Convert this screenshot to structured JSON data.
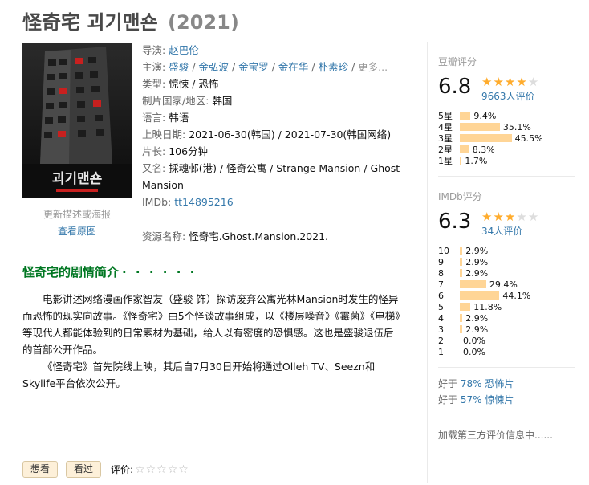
{
  "title": {
    "main": "怪奇宅 괴기맨숀",
    "year": "(2021)"
  },
  "poster": {
    "korean_title": "괴기맨숀",
    "link_update": "更新描述或海报",
    "link_view": "查看原图"
  },
  "info": {
    "director_label": "导演:",
    "director": "赵巴伦",
    "cast_label": "主演:",
    "cast": [
      "盛骏",
      "金弘波",
      "金宝罗",
      "金在华",
      "朴素珍"
    ],
    "cast_separator": " / ",
    "cast_more": "更多...",
    "genre_label": "类型:",
    "genre": "惊悚 / 恐怖",
    "country_label": "制片国家/地区:",
    "country": "韩国",
    "language_label": "语言:",
    "language": "韩语",
    "release_label": "上映日期:",
    "release": "2021-06-30(韩国) / 2021-07-30(韩国网络)",
    "runtime_label": "片长:",
    "runtime": "106分钟",
    "aka_label": "又名:",
    "aka": "採魂邨(港) / 怪奇公寓 / Strange Mansion / Ghost Mansion",
    "imdb_label": "IMDb:",
    "imdb": "tt14895216",
    "resource_label": "资源名称:",
    "resource": "怪奇宅.Ghost.Mansion.2021."
  },
  "synopsis": {
    "title": "怪奇宅的剧情简介",
    "dots": "· · · · · ·",
    "p1": "电影讲述网络漫画作家智友（盛骏 饰）探访废弃公寓光林Mansion时发生的怪异而恐怖的现实向故事。《怪奇宅》由5个怪谈故事组成，以《楼层噪音》《霉菌》《电梯》等现代人都能体验到的日常素材为基础，给人以有密度的恐惧感。这也是盛骏退伍后的首部公开作品。",
    "p2": "《怪奇宅》首先院线上映，其后自7月30日开始将通过Olleh TV、Seezn和Skylife平台依次公开。"
  },
  "actions": {
    "want": "想看",
    "seen": "看过",
    "rate_label": "评价:",
    "stars_empty": "☆☆☆☆☆"
  },
  "douban": {
    "label": "豆瓣评分",
    "score": "6.8",
    "stars_filled": 3.5,
    "votes": "9663人评价",
    "bars": [
      {
        "label": "5星",
        "pct": "9.4%",
        "value": 9.4
      },
      {
        "label": "4星",
        "pct": "35.1%",
        "value": 35.1
      },
      {
        "label": "3星",
        "pct": "45.5%",
        "value": 45.5
      },
      {
        "label": "2星",
        "pct": "8.3%",
        "value": 8.3
      },
      {
        "label": "1星",
        "pct": "1.7%",
        "value": 1.7
      }
    ]
  },
  "imdb_rating": {
    "label": "IMDb评分",
    "score": "6.3",
    "stars_filled": 3,
    "votes": "34人评价",
    "bars": [
      {
        "label": "10",
        "pct": "2.9%",
        "value": 2.9
      },
      {
        "label": "9",
        "pct": "2.9%",
        "value": 2.9
      },
      {
        "label": "8",
        "pct": "2.9%",
        "value": 2.9
      },
      {
        "label": "7",
        "pct": "29.4%",
        "value": 29.4
      },
      {
        "label": "6",
        "pct": "44.1%",
        "value": 44.1
      },
      {
        "label": "5",
        "pct": "11.8%",
        "value": 11.8
      },
      {
        "label": "4",
        "pct": "2.9%",
        "value": 2.9
      },
      {
        "label": "3",
        "pct": "2.9%",
        "value": 2.9
      },
      {
        "label": "2",
        "pct": "0.0%",
        "value": 0.0
      },
      {
        "label": "1",
        "pct": "0.0%",
        "value": 0.0
      }
    ]
  },
  "better_than": [
    {
      "prefix": "好于 ",
      "pct": "78%",
      "genre": "恐怖片"
    },
    {
      "prefix": "好于 ",
      "pct": "57%",
      "genre": "惊悚片"
    }
  ],
  "third_party": "加载第三方评价信息中......",
  "colors": {
    "link": "#3377aa",
    "green_title": "#007722",
    "star": "#ffac2d",
    "bar": "#ffd596",
    "button_bg": "#fdf0d9"
  }
}
